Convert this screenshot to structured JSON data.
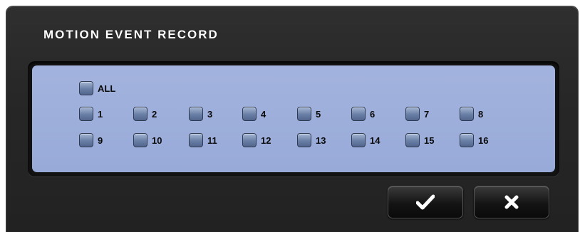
{
  "dialog": {
    "title": "MOTION EVENT RECORD",
    "all_label": "ALL",
    "channels": [
      "1",
      "2",
      "3",
      "4",
      "5",
      "6",
      "7",
      "8",
      "9",
      "10",
      "11",
      "12",
      "13",
      "14",
      "15",
      "16"
    ]
  },
  "buttons": {
    "confirm_icon": "checkmark-icon",
    "cancel_icon": "close-icon"
  },
  "colors": {
    "panel": "#9caedb",
    "dialog_bg": "#2a2a2a",
    "checkbox": "#6a7fa5"
  }
}
